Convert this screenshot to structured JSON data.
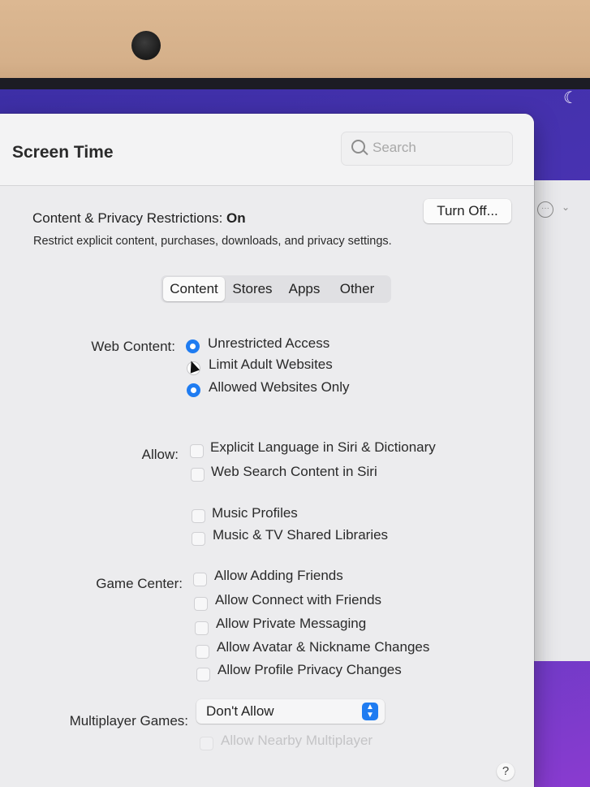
{
  "window": {
    "title": "Screen Time",
    "search_placeholder": "Search"
  },
  "restrictions": {
    "label": "Content & Privacy Restrictions:",
    "status": "On",
    "description": "Restrict explicit content, purchases, downloads, and privacy settings.",
    "turn_off_label": "Turn Off..."
  },
  "tabs": [
    {
      "label": "Content",
      "active": true
    },
    {
      "label": "Stores",
      "active": false
    },
    {
      "label": "Apps",
      "active": false
    },
    {
      "label": "Other",
      "active": false
    }
  ],
  "web_content": {
    "label": "Web Content:",
    "options": [
      {
        "label": "Unrestricted Access",
        "selected": true
      },
      {
        "label": "Limit Adult Websites",
        "selected": false
      },
      {
        "label": "Allowed Websites Only",
        "selected": true
      }
    ]
  },
  "allow": {
    "label": "Allow:",
    "items": [
      {
        "label": "Explicit Language in Siri & Dictionary",
        "checked": false
      },
      {
        "label": "Web Search Content in Siri",
        "checked": false
      },
      {
        "label": "Music Profiles",
        "checked": false
      },
      {
        "label": "Music & TV Shared Libraries",
        "checked": false
      }
    ]
  },
  "game_center": {
    "label": "Game Center:",
    "items": [
      {
        "label": "Allow Adding Friends",
        "checked": false
      },
      {
        "label": "Allow Connect with Friends",
        "checked": false
      },
      {
        "label": "Allow Private Messaging",
        "checked": false
      },
      {
        "label": "Allow Avatar & Nickname Changes",
        "checked": false
      },
      {
        "label": "Allow Profile Privacy Changes",
        "checked": false
      }
    ]
  },
  "multiplayer": {
    "label": "Multiplayer Games:",
    "value": "Don't Allow",
    "nearby_label": "Allow Nearby Multiplayer",
    "nearby_enabled": false
  },
  "help_label": "?",
  "colors": {
    "accent": "#1f7cf1",
    "desktop": "#4a33b3"
  }
}
